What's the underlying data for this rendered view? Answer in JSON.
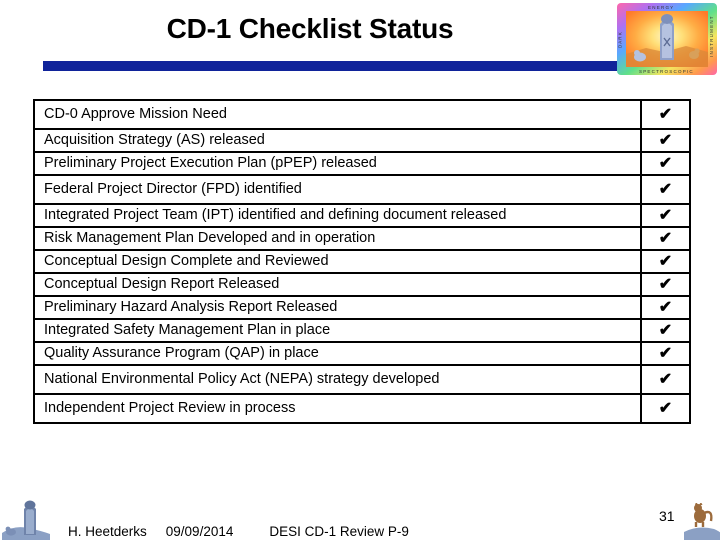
{
  "slide": {
    "title": "CD-1 Checklist Status",
    "accent_color": "#10239A",
    "background_color": "#FFFFFF",
    "text_color": "#000000"
  },
  "logo": {
    "name": "desi-doe-logo",
    "border_colors": [
      "#ff5fa2",
      "#b06bf0",
      "#5fa8ff",
      "#5fe08a",
      "#f5e45f",
      "#ff8f4f"
    ],
    "top_text": "E N E R G Y",
    "left_text": "D A R K",
    "right_text": "I N S T R U M E N T",
    "bottom_text": "S P E C T R O S C O P I C"
  },
  "table": {
    "check_symbol": "✔",
    "rows": [
      {
        "item": "CD-0 Approve Mission Need",
        "status": "✔",
        "tall": true
      },
      {
        "item": "Acquisition Strategy (AS) released",
        "status": "✔",
        "tall": false
      },
      {
        "item": "Preliminary Project Execution Plan (pPEP) released",
        "status": "✔",
        "tall": false
      },
      {
        "item": "Federal Project Director (FPD) identified",
        "status": "✔",
        "tall": true
      },
      {
        "item": "Integrated Project Team (IPT) identified and defining document released",
        "status": "✔",
        "tall": false
      },
      {
        "item": "Risk Management Plan Developed and in operation",
        "status": "✔",
        "tall": false
      },
      {
        "item": "Conceptual Design Complete and Reviewed",
        "status": "✔",
        "tall": false
      },
      {
        "item": "Conceptual Design Report Released",
        "status": "✔",
        "tall": false
      },
      {
        "item": "Preliminary Hazard Analysis Report Released",
        "status": "✔",
        "tall": false
      },
      {
        "item": "Integrated Safety Management Plan in place",
        "status": "✔",
        "tall": false
      },
      {
        "item": "Quality Assurance Program (QAP) in place",
        "status": "✔",
        "tall": false
      },
      {
        "item": "National Environmental Policy Act (NEPA) strategy developed",
        "status": "✔",
        "tall": true
      },
      {
        "item": "Independent Project Review in process",
        "status": "✔",
        "tall": true
      }
    ]
  },
  "footer": {
    "author": "H. Heetderks",
    "date": "09/09/2014",
    "event": "DESI CD-1 Review  P-9",
    "page_number": "31"
  }
}
